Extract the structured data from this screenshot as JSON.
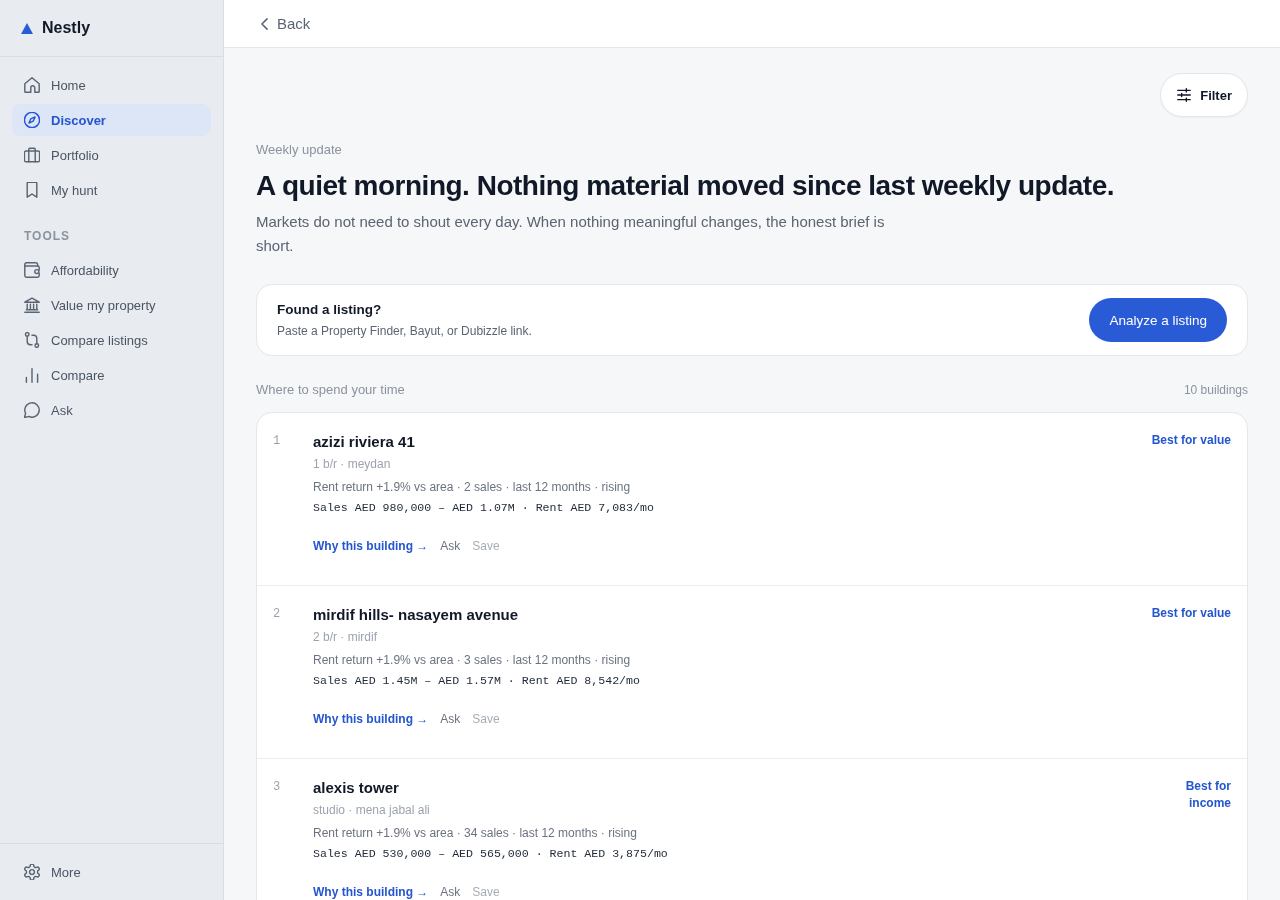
{
  "sidebar": {
    "brand": "Nestly",
    "nav": [
      {
        "label": "Home",
        "selected": false
      },
      {
        "label": "Discover",
        "selected": true
      },
      {
        "label": "Portfolio",
        "selected": false
      },
      {
        "label": "My hunt",
        "selected": false
      }
    ],
    "tools_heading": "TOOLS",
    "tools": [
      {
        "label": "Affordability",
        "selected": false
      },
      {
        "label": "Value my property",
        "selected": false
      },
      {
        "label": "Compare listings",
        "selected": false
      },
      {
        "label": "Compare",
        "selected": false
      },
      {
        "label": "Ask",
        "selected": false
      }
    ],
    "footer": [
      {
        "label": "More",
        "selected": false
      }
    ]
  },
  "top_bar": {
    "back": "Back"
  },
  "filter": {
    "label": "Filter"
  },
  "brief": {
    "eyebrow": "Weekly update",
    "headline": "A quiet morning. Nothing material moved since last weekly update.",
    "body": "Markets do not need to shout every day. When nothing meaningful changes, the honest brief is short."
  },
  "listing_prompt": {
    "title": "Found a listing?",
    "subtitle": "Paste a Property Finder, Bayut, or Dubizzle link.",
    "button": "Analyze a listing"
  },
  "buildings": {
    "heading": "Where to spend your time",
    "count": "10 buildings",
    "rows": [
      {
        "rank": "1",
        "name": "azizi riviera 41",
        "details": "1 b/r · meydan",
        "stats": "Rent return +1.9% vs area · 2 sales · last 12 months · rising",
        "prices": "Sales AED 980,000 – AED 1.07M · Rent AED 7,083/mo",
        "tag": "Best for value",
        "actions": [
          {
            "label": "Why this building →",
            "kind": "link",
            "disabled": false
          },
          {
            "label": "Ask",
            "kind": "plain",
            "disabled": false
          },
          {
            "label": "Save",
            "kind": "plain",
            "disabled": true
          }
        ]
      },
      {
        "rank": "2",
        "name": "mirdif hills- nasayem avenue",
        "details": "2 b/r · mirdif",
        "stats": "Rent return +1.9% vs area · 3 sales · last 12 months · rising",
        "prices": "Sales AED 1.45M – AED 1.57M · Rent AED 8,542/mo",
        "tag": "Best for value",
        "actions": [
          {
            "label": "Why this building →",
            "kind": "link",
            "disabled": false
          },
          {
            "label": "Ask",
            "kind": "plain",
            "disabled": false
          },
          {
            "label": "Save",
            "kind": "plain",
            "disabled": true
          }
        ]
      },
      {
        "rank": "3",
        "name": "alexis tower",
        "details": "studio · mena jabal ali",
        "stats": "Rent return +1.9% vs area · 34 sales · last 12 months · rising",
        "prices": "Sales AED 530,000 – AED 565,000 · Rent AED 3,875/mo",
        "tag": "Best for income",
        "actions": [
          {
            "label": "Why this building →",
            "kind": "link",
            "disabled": false
          },
          {
            "label": "Ask",
            "kind": "plain",
            "disabled": false
          },
          {
            "label": "Save",
            "kind": "plain",
            "disabled": true
          }
        ]
      }
    ]
  }
}
